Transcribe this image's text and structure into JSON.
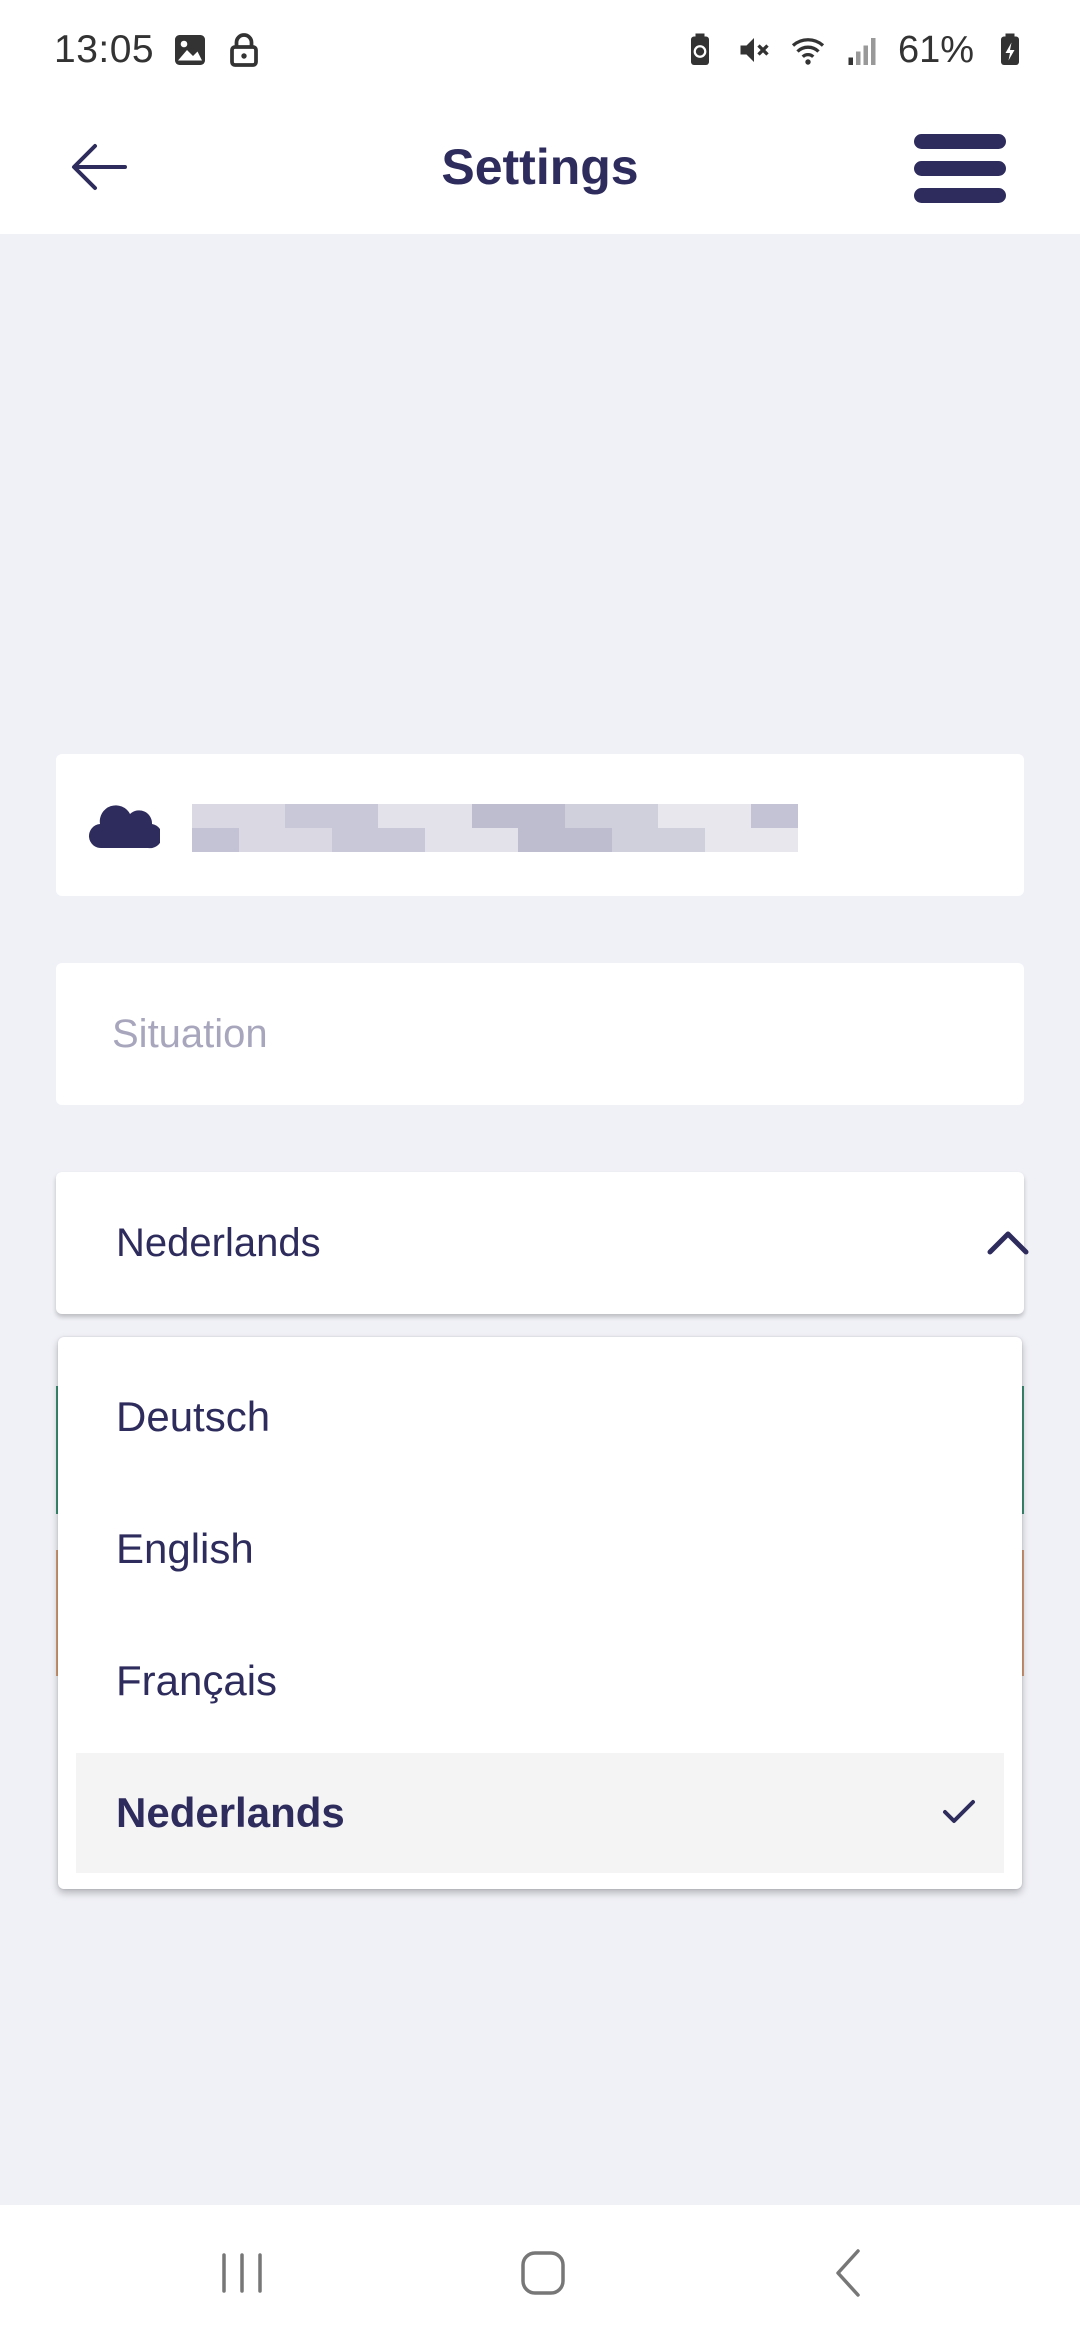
{
  "status_bar": {
    "time": "13:05",
    "battery": "61%",
    "icons": [
      "gallery-icon",
      "lock-icon",
      "battery-saver-icon",
      "mute-icon",
      "wifi-icon",
      "signal-icon",
      "battery-icon"
    ]
  },
  "header": {
    "title": "Settings",
    "back_icon": "arrow-left-icon",
    "menu_icon": "hamburger-menu-icon"
  },
  "account": {
    "icon": "cloud-icon"
  },
  "situation": {
    "placeholder": "Situation",
    "value": ""
  },
  "language": {
    "selected": "Nederlands",
    "options": [
      {
        "label": "Deutsch",
        "selected": false
      },
      {
        "label": "English",
        "selected": false
      },
      {
        "label": "Français",
        "selected": false
      },
      {
        "label": "Nederlands",
        "selected": true
      }
    ]
  },
  "colors": {
    "primary": "#2e2c5c",
    "background": "#f0f1f7",
    "placeholder": "#a7a6bd",
    "selected_option_bg": "#f4f4f4"
  },
  "nav_bar": {
    "icons": [
      "recents-icon",
      "home-icon",
      "back-icon"
    ]
  }
}
